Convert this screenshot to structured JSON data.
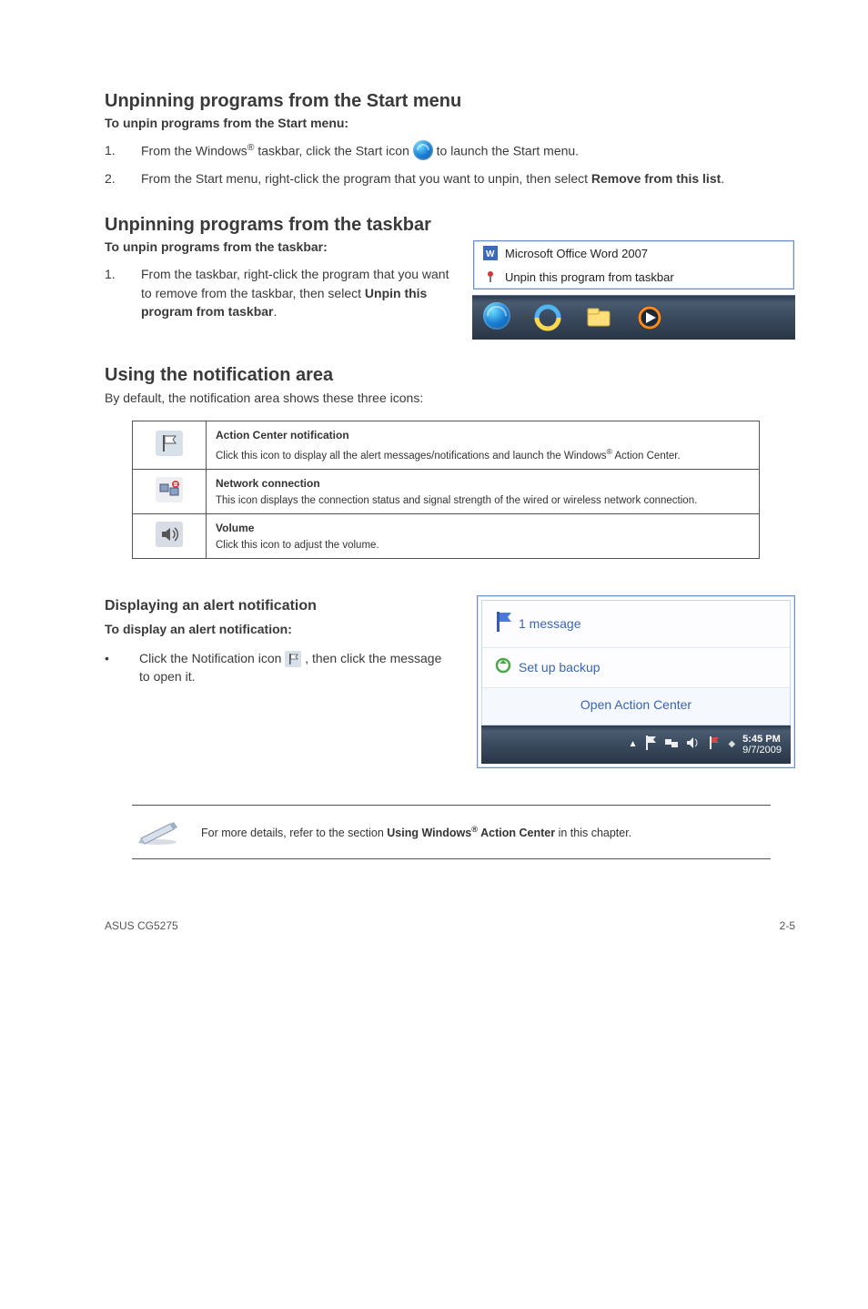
{
  "sec1": {
    "heading": "Unpinning programs from the Start menu",
    "sub": "To unpin programs from the Start menu:",
    "steps": [
      {
        "n": "1.",
        "pre": "From the Windows",
        "sup": "®",
        "mid": " taskbar, click the Start icon ",
        "post": " to launch the Start menu.",
        "hasIcon": true
      },
      {
        "n": "2.",
        "full": "From the Start menu, right-click the program that you want to unpin, then select ",
        "bold": "Remove from this list",
        "tail": "."
      }
    ]
  },
  "sec2": {
    "heading": "Unpinning programs from the taskbar",
    "sub": "To unpin programs from the taskbar:",
    "step_n": "1.",
    "step_pre": "From the taskbar, right-click the program that you want to remove from the taskbar, then select ",
    "step_bold": "Unpin this program from taskbar",
    "step_tail": ".",
    "popup": {
      "item1": "Microsoft Office Word 2007",
      "item2": "Unpin this program from taskbar"
    }
  },
  "sec3": {
    "heading": "Using the notification area",
    "intro": "By default, the notification area shows these three icons:",
    "rows": [
      {
        "icon": "flag",
        "title": "Action Center notification",
        "desc_pre": "Click this icon to display all the alert messages/notifications and launch the Windows",
        "sup": "®",
        "desc_post": " Action Center."
      },
      {
        "icon": "net",
        "title": "Network connection",
        "desc": "This icon displays the connection status and signal strength of the wired or wireless network connection."
      },
      {
        "icon": "vol",
        "title": "Volume",
        "desc": "Click this icon to adjust the volume."
      }
    ]
  },
  "sec4": {
    "heading": "Displaying an alert notification",
    "sub": "To display an alert notification:",
    "bullet": "•",
    "line_pre": "Click the Notification icon ",
    "line_post": ", then click the message to open it.",
    "balloon": {
      "msg": "1 message",
      "backup": "Set up backup",
      "open": "Open Action Center",
      "time": "5:45 PM",
      "date": "9/7/2009"
    }
  },
  "note": {
    "pre": "For more details, refer to the section ",
    "bold_pre": "Using Windows",
    "sup": "®",
    "bold_post": " Action Center",
    "tail": " in this chapter."
  },
  "footer": {
    "left": "ASUS CG5275",
    "right": "2-5"
  },
  "icons": {
    "start": "start-icon",
    "flag": "flag-icon",
    "net": "network-icon",
    "vol": "volume-icon",
    "word": "word-icon",
    "pin": "pin-icon",
    "ie": "ie-icon",
    "explorer": "explorer-icon",
    "wmp": "wmp-icon",
    "pencil": "pencil-icon"
  }
}
